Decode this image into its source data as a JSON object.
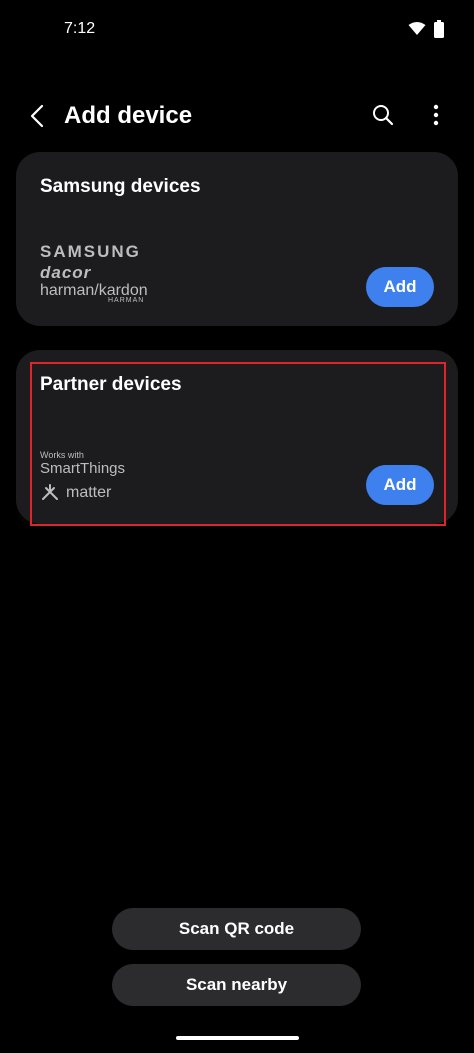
{
  "status_bar": {
    "time": "7:12"
  },
  "app_bar": {
    "title": "Add device"
  },
  "samsung_card": {
    "title": "Samsung devices",
    "brands": {
      "samsung": "SAMSUNG",
      "dacor": "dacor",
      "harman": "harman/kardon",
      "harman_sub": "HARMAN"
    },
    "add_label": "Add"
  },
  "partner_card": {
    "title": "Partner devices",
    "works_with": "Works with",
    "smartthings": "SmartThings",
    "matter": "matter",
    "add_label": "Add"
  },
  "actions": {
    "scan_qr": "Scan QR code",
    "scan_nearby": "Scan nearby"
  },
  "colors": {
    "accent": "#3e80ee",
    "card_bg": "#1c1c1e",
    "highlight": "#e0242b"
  }
}
